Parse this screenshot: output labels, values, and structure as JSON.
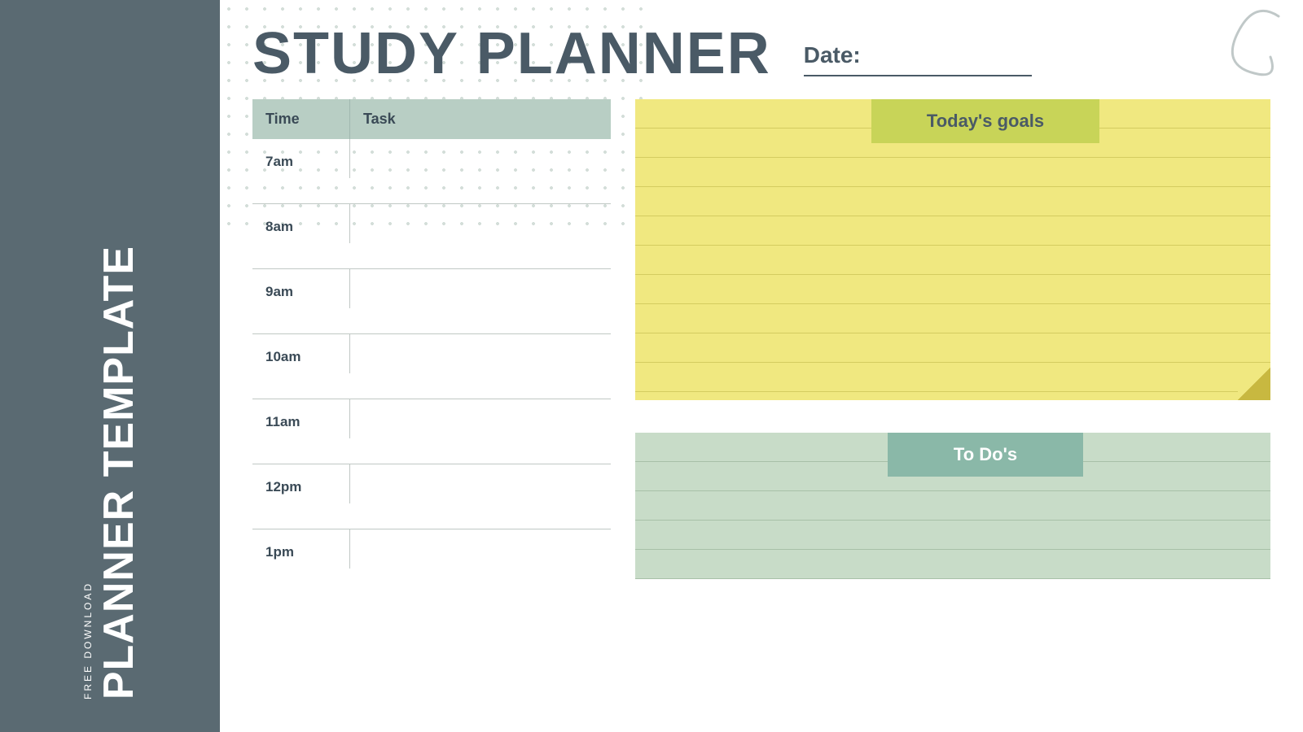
{
  "sidebar": {
    "background_color": "#5a6a72",
    "free_download_label": "FREE DOWNLOAD",
    "planner_template_label": "PLANNER TEMPLATE"
  },
  "header": {
    "title": "STUDY PLANNER",
    "date_label": "Date:",
    "date_line_placeholder": ""
  },
  "schedule": {
    "col_time_label": "Time",
    "col_task_label": "Task",
    "rows": [
      {
        "time": "7am",
        "task": ""
      },
      {
        "time": "8am",
        "task": ""
      },
      {
        "time": "9am",
        "task": ""
      },
      {
        "time": "10am",
        "task": ""
      },
      {
        "time": "11am",
        "task": ""
      },
      {
        "time": "12pm",
        "task": ""
      },
      {
        "time": "1pm",
        "task": ""
      }
    ]
  },
  "goals_section": {
    "tab_label": "Today's goals",
    "lines": 8
  },
  "todos_section": {
    "tab_label": "To Do's",
    "lines": 4
  },
  "colors": {
    "sidebar_bg": "#5a6a72",
    "header_bg": "#ffffff",
    "schedule_header_bg": "#b8cec4",
    "goals_tab_bg": "#c8d458",
    "goals_body_bg": "#f0e880",
    "todos_tab_bg": "#8ab8a8",
    "todos_body_bg": "#c8dcc8",
    "text_dark": "#4a5a66"
  }
}
